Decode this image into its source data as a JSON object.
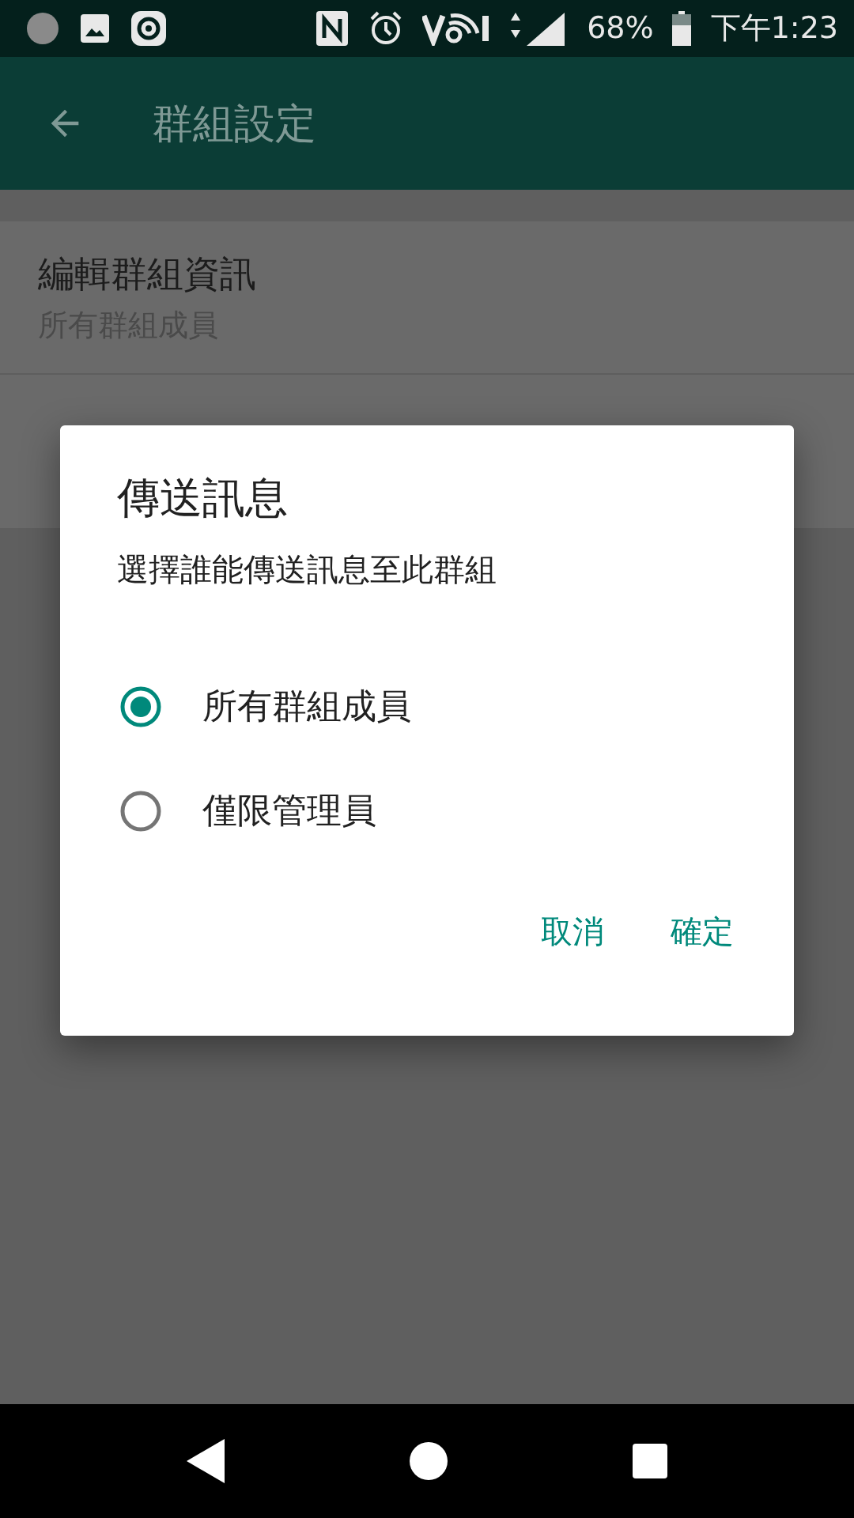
{
  "status_bar": {
    "battery": "68%",
    "time": "下午1:23"
  },
  "app_bar": {
    "title": "群組設定"
  },
  "settings": [
    {
      "title": "編輯群組資訊",
      "subtitle": "所有群組成員"
    }
  ],
  "dialog": {
    "title": "傳送訊息",
    "message": "選擇誰能傳送訊息至此群組",
    "options": [
      {
        "label": "所有群組成員",
        "selected": true
      },
      {
        "label": "僅限管理員",
        "selected": false
      }
    ],
    "buttons": [
      "取消",
      "確定"
    ]
  }
}
